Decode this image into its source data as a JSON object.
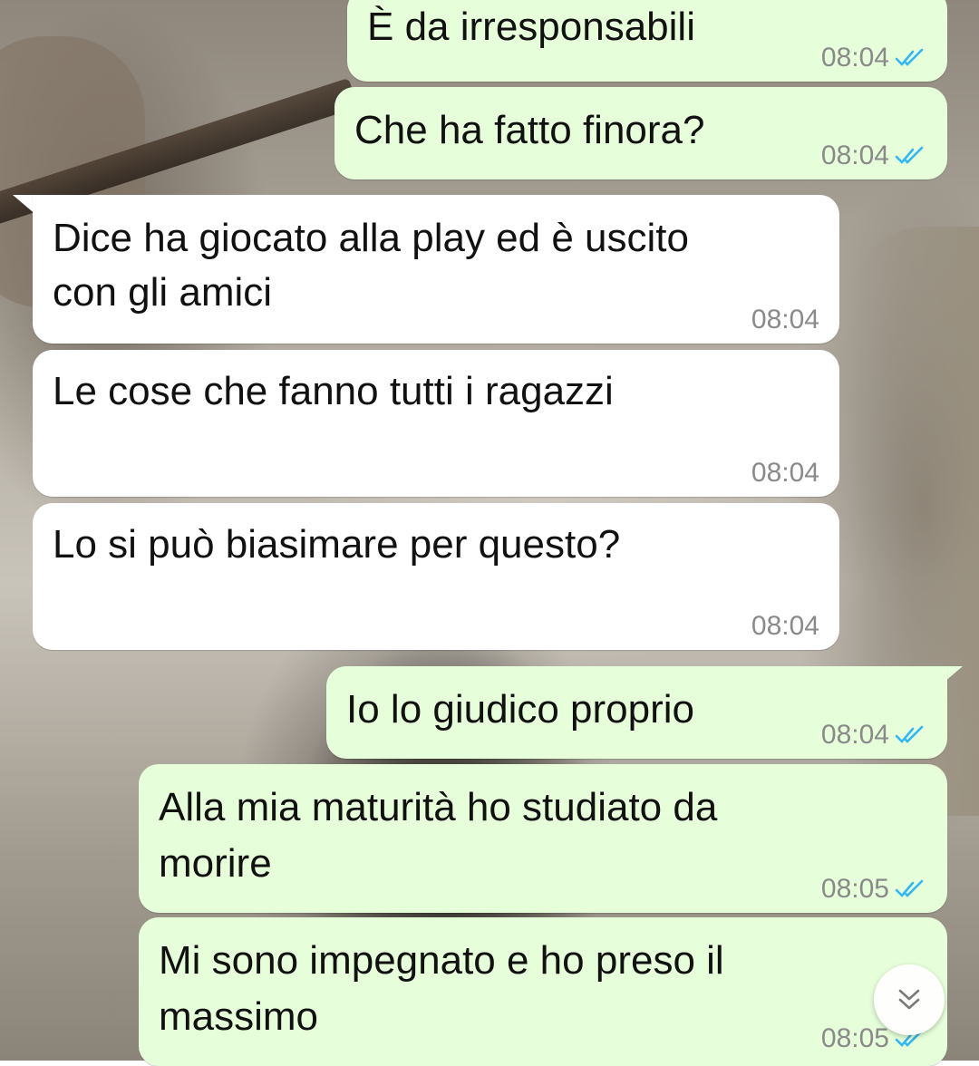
{
  "colors": {
    "outgoing_bubble": "#e6ffda",
    "incoming_bubble": "#ffffff",
    "time_text": "#8a8a8a",
    "read_ticks": "#34b7f1"
  },
  "messages": [
    {
      "direction": "outgoing",
      "text_lines": [
        "È da irresponsabili"
      ],
      "time": "08:04",
      "status": "read"
    },
    {
      "direction": "outgoing",
      "text_lines": [
        "Che ha fatto finora?"
      ],
      "time": "08:04",
      "status": "read"
    },
    {
      "direction": "incoming",
      "text_lines": [
        "Dice ha giocato alla play ed è uscito",
        "con gli amici"
      ],
      "time": "08:04"
    },
    {
      "direction": "incoming",
      "text_lines": [
        "Le cose che fanno tutti i ragazzi"
      ],
      "time": "08:04"
    },
    {
      "direction": "incoming",
      "text_lines": [
        "Lo si può biasimare per questo?"
      ],
      "time": "08:04"
    },
    {
      "direction": "outgoing",
      "text_lines": [
        "Io lo giudico proprio"
      ],
      "time": "08:04",
      "status": "read"
    },
    {
      "direction": "outgoing",
      "text_lines": [
        "Alla mia maturità ho studiato da",
        "morire"
      ],
      "time": "08:05",
      "status": "read"
    },
    {
      "direction": "outgoing",
      "text_lines": [
        "Mi sono impegnato e ho preso il",
        "massimo"
      ],
      "time": "08:05",
      "status": "read"
    }
  ],
  "controls": {
    "scroll_down_icon": "chevron-double-down-icon",
    "read_icon": "double-check-icon"
  }
}
